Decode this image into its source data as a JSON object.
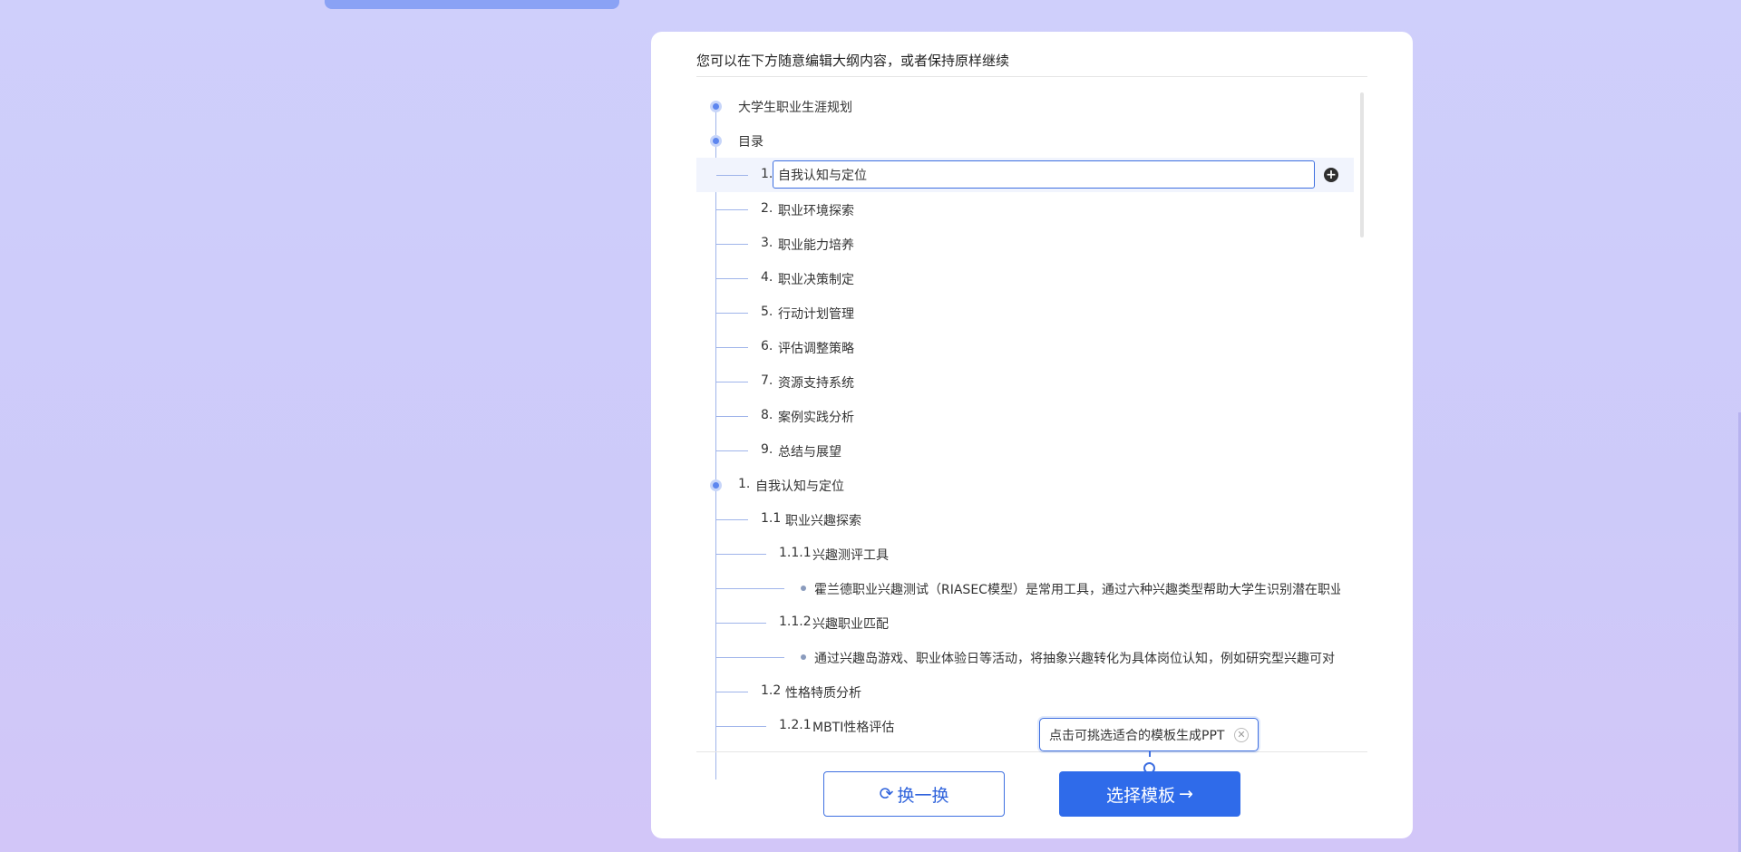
{
  "header": {
    "hint": "您可以在下方随意编辑大纲内容，或者保持原样继续"
  },
  "outline": {
    "title": "大学生职业生涯规划",
    "toc_heading": "目录",
    "toc": [
      {
        "num": "1.",
        "text": "自我认知与定位"
      },
      {
        "num": "2.",
        "text": "职业环境探索"
      },
      {
        "num": "3.",
        "text": "职业能力培养"
      },
      {
        "num": "4.",
        "text": "职业决策制定"
      },
      {
        "num": "5.",
        "text": "行动计划管理"
      },
      {
        "num": "6.",
        "text": "评估调整策略"
      },
      {
        "num": "7.",
        "text": "资源支持系统"
      },
      {
        "num": "8.",
        "text": "案例实践分析"
      },
      {
        "num": "9.",
        "text": "总结与展望"
      }
    ],
    "section1": {
      "num": "1.",
      "text": "自我认知与定位"
    },
    "s1_1": {
      "num": "1.1",
      "text": "职业兴趣探索"
    },
    "s1_1_1": {
      "num": "1.1.1",
      "text": "兴趣测评工具"
    },
    "s1_1_1_bullet": "霍兰德职业兴趣测试（RIASEC模型）是常用工具，通过六种兴趣类型帮助大学生识别潜在职业",
    "s1_1_2": {
      "num": "1.1.2",
      "text": "兴趣职业匹配"
    },
    "s1_1_2_bullet": "通过兴趣岛游戏、职业体验日等活动，将抽象兴趣转化为具体岗位认知，例如研究型兴趣可对",
    "s1_2": {
      "num": "1.2",
      "text": "性格特质分析"
    },
    "s1_2_1": {
      "num": "1.2.1",
      "text": "MBTI性格评估"
    }
  },
  "tooltip": {
    "text": "点击可挑选适合的模板生成PPT"
  },
  "buttons": {
    "swap_label": "换一换",
    "template_label": "选择模板",
    "swap_icon": "refresh-icon",
    "template_icon": "arrow-right-icon"
  },
  "colors": {
    "accent": "#2f6bea",
    "tree_line": "#9fb4ea"
  }
}
